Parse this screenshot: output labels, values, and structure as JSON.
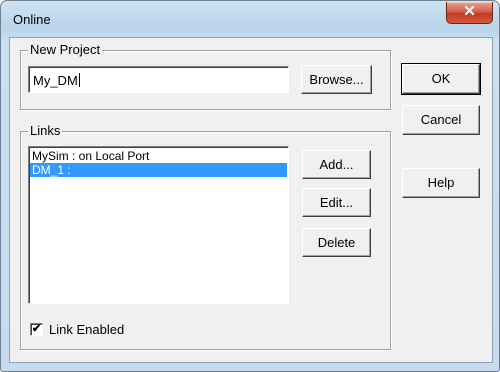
{
  "window": {
    "title": "Online",
    "close_glyph": "✕"
  },
  "new_project": {
    "legend": "New Project",
    "value": "My_DM",
    "browse_label": "Browse..."
  },
  "links": {
    "legend": "Links",
    "items": [
      {
        "label": "MySim : on Local Port",
        "selected": false
      },
      {
        "label": "DM_1 :",
        "selected": true
      }
    ],
    "add_label": "Add...",
    "edit_label": "Edit...",
    "delete_label": "Delete",
    "link_enabled_label": "Link Enabled",
    "link_enabled_checked": true,
    "check_glyph": "✔"
  },
  "actions": {
    "ok_label": "OK",
    "cancel_label": "Cancel",
    "help_label": "Help"
  },
  "colors": {
    "selection": "#3399ff",
    "close_button": "#c43a22"
  }
}
